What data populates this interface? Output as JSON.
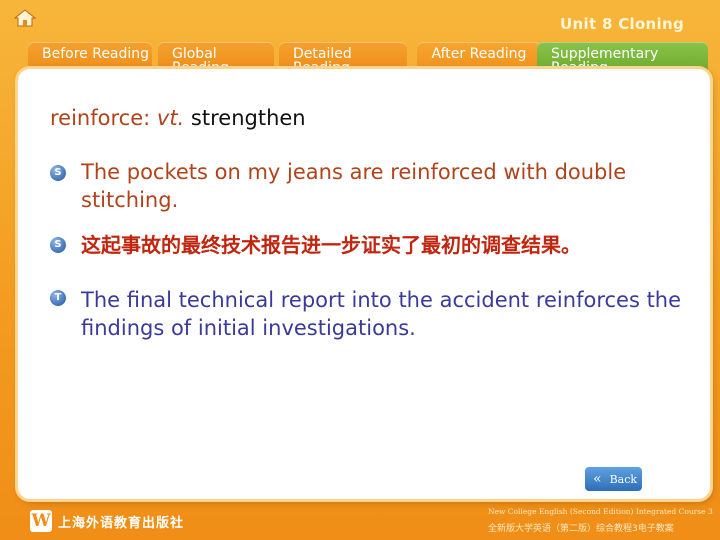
{
  "header": {
    "home_icon": "home-icon",
    "unit_title": "Unit 8 Cloning"
  },
  "tabs": [
    {
      "label": "Before Reading"
    },
    {
      "label": "Global Reading"
    },
    {
      "label": "Detailed Reading"
    },
    {
      "label": "After Reading"
    },
    {
      "label": "Supplementary Reading"
    }
  ],
  "content": {
    "word": "reinforce:",
    "pos": "vt.",
    "definition": "strengthen",
    "items": [
      {
        "bullet": "S",
        "text": "The pockets on my jeans are reinforced with double stitching."
      },
      {
        "bullet": "S",
        "text": "这起事故的最终技术报告进一步证实了最初的调查结果。"
      },
      {
        "bullet": "T",
        "text": "The final technical report into the accident reinforces the findings of initial investigations."
      }
    ]
  },
  "nav": {
    "back_label": "Back"
  },
  "footer": {
    "publisher": "上海外语教育出版社",
    "course_en": "New College English (Second Edition) Integrated Course 3",
    "course_cn": "全新版大学英语（第二版）综合教程3电子教案"
  },
  "colors": {
    "background": "#f39a1f",
    "tab_active": "#6aa82c",
    "accent_red": "#b0431a",
    "accent_blue": "#3a3a9a"
  }
}
